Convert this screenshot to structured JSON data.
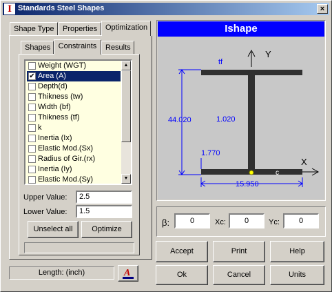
{
  "window": {
    "title": "Standards Steel Shapes",
    "icon": "I",
    "close_label": "×"
  },
  "tabs_top": [
    "Shape Type",
    "Properties",
    "Optimization"
  ],
  "tabs_sub": [
    "Shapes",
    "Constraints",
    "Results"
  ],
  "constraints": {
    "items": [
      {
        "label": "Weight (WGT)",
        "checked": false,
        "selected": false
      },
      {
        "label": "Area (A)",
        "checked": true,
        "selected": true
      },
      {
        "label": "Depth(d)",
        "checked": false,
        "selected": false
      },
      {
        "label": "Thikness (tw)",
        "checked": false,
        "selected": false
      },
      {
        "label": "Width (bf)",
        "checked": false,
        "selected": false
      },
      {
        "label": "Thikness (tf)",
        "checked": false,
        "selected": false
      },
      {
        "label": "k",
        "checked": false,
        "selected": false
      },
      {
        "label": "Inertia (Ix)",
        "checked": false,
        "selected": false
      },
      {
        "label": "Elastic Mod.(Sx)",
        "checked": false,
        "selected": false
      },
      {
        "label": "Radius of Gir.(rx)",
        "checked": false,
        "selected": false
      },
      {
        "label": "Inertia (Iy)",
        "checked": false,
        "selected": false
      },
      {
        "label": "Elastic Mod.(Sy)",
        "checked": false,
        "selected": false
      }
    ],
    "upper_label": "Upper Value:",
    "upper_value": "2.5",
    "lower_label": "Lower Value:",
    "lower_value": "1.5",
    "unselect_label": "Unselect all",
    "optimize_label": "Optimize"
  },
  "status": {
    "length_label": "Length: (inch)"
  },
  "shape": {
    "title": "Ishape",
    "tf_label": "tf",
    "y_axis": "Y",
    "x_axis": "X",
    "depth": "44.020",
    "web_thickness": "1.020",
    "k_value": "1.770",
    "width": "15.950",
    "centroid_label": "c"
  },
  "coords": {
    "beta_label": "β:",
    "beta_value": "0",
    "xc_label": "Xc:",
    "xc_value": "0",
    "yc_label": "Yc:",
    "yc_value": "0"
  },
  "buttons": {
    "accept": "Accept",
    "print": "Print",
    "help": "Help",
    "ok": "Ok",
    "cancel": "Cancel",
    "units": "Units"
  },
  "colors": {
    "title_start": "#0a246a",
    "title_end": "#a6caf0",
    "header_blue": "#0000ff",
    "dimension_blue": "#0000ff",
    "list_bg": "#ffffe1",
    "beam": "#303030"
  }
}
